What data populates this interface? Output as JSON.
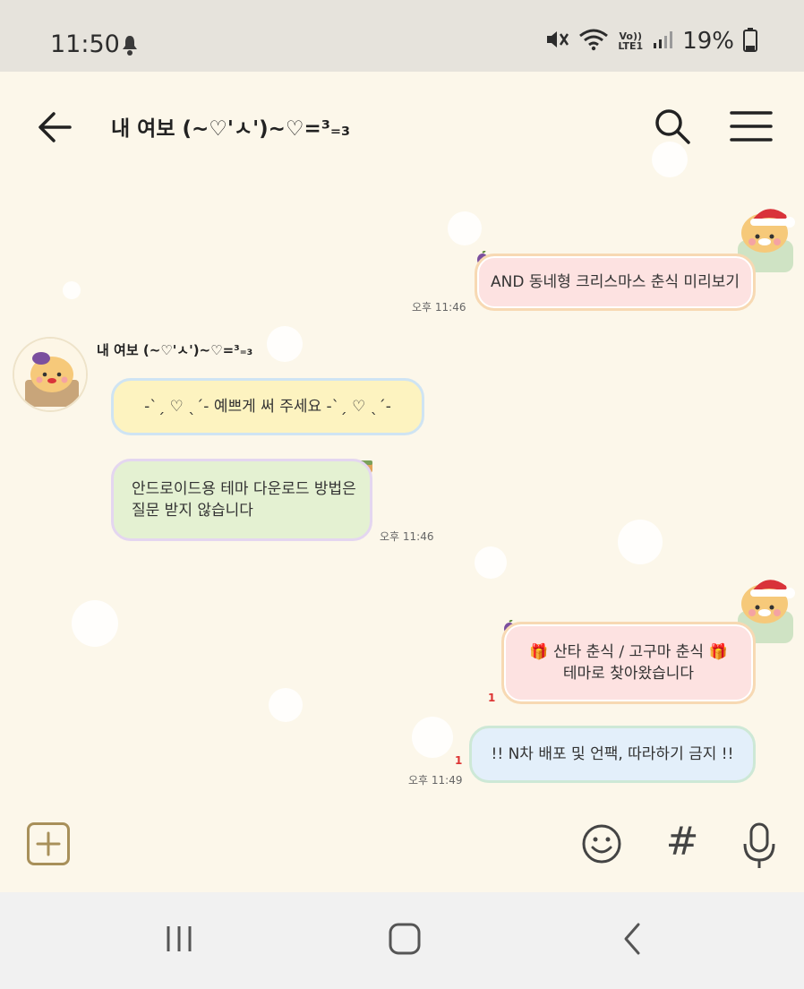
{
  "status_bar": {
    "time": "11:50",
    "network_label_top": "Vo))",
    "network_label_bottom": "LTE1",
    "battery": "19%"
  },
  "header": {
    "title": "내 여보 (~♡'ㅅ')~♡=³₌₃",
    "icons": [
      "back-arrow-icon",
      "search-icon",
      "menu-icon"
    ]
  },
  "messages": [
    {
      "side": "right",
      "text": "AND 동네형 크리스마스 춘식 미리보기",
      "time": "오후 11:46"
    },
    {
      "side": "left",
      "sender": "내 여보 (~♡'ㅅ')~♡=³₌₃",
      "text": "-ˋˏ ♡ ˎˊ- 예쁘게 써 주세요 -ˋˏ ♡ ˎˊ-"
    },
    {
      "side": "left",
      "text_line1": "안드로이드용 테마 다운로드 방법은",
      "text_line2": "질문 받지 않습니다",
      "time": "오후 11:46"
    },
    {
      "side": "right",
      "text_line1": "🎁 산타 춘식 / 고구마 춘식 🎁",
      "text_line2": "테마로 찾아왔습니다",
      "unread": "1"
    },
    {
      "side": "right",
      "text": "!! N차 배포 및 언팩, 따라하기 금지 !!",
      "unread": "1",
      "time": "오후 11:49"
    }
  ],
  "input_bar": {
    "icons": [
      "plus-icon",
      "emoji-icon",
      "hashtag-icon",
      "microphone-icon"
    ],
    "hash_glyph": "#"
  },
  "nav_bar": {
    "icons": [
      "recents-icon",
      "home-icon",
      "back-icon"
    ]
  },
  "colors": {
    "chat_background": "#fcf7ea",
    "status_bar": "#e6e3dc",
    "nav_bar": "#f1f1f1",
    "accent_gold": "#a8905a"
  }
}
